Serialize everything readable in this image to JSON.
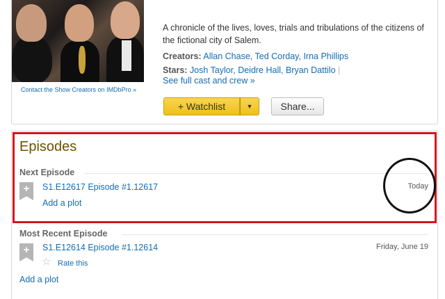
{
  "header": {
    "photo_caption": "Contact the Show Creators on IMDbPro »",
    "summary": "A chronicle of the lives, loves, trials and tribulations of the citizens of the fictional city of Salem.",
    "creators_label": "Creators:",
    "creators": [
      "Allan Chase,",
      "Ted Corday,",
      "Irna Phillips"
    ],
    "stars_label": "Stars:",
    "stars": [
      "Josh Taylor,",
      "Deidre Hall,",
      "Bryan Dattilo"
    ],
    "separator": "|",
    "full_cast_link": "See full cast and crew »",
    "watchlist_label": "+ Watchlist",
    "watchlist_arrow_icon": "caret-down-icon",
    "share_label": "Share..."
  },
  "episodes": {
    "title": "Episodes",
    "next": {
      "heading": "Next Episode",
      "plus_icon": "plus-bookmark-icon",
      "plus_glyph": "+",
      "link": "S1.E12617 Episode #1.12617",
      "add_plot": "Add a plot",
      "date": "Today"
    },
    "recent": {
      "heading": "Most Recent Episode",
      "plus_icon": "plus-bookmark-icon",
      "plus_glyph": "+",
      "link": "S1.E12614 Episode #1.12614",
      "date": "Friday, June 19",
      "rate_label": "Rate this",
      "add_plot": "Add a plot"
    }
  },
  "colors": {
    "link": "#136cb2",
    "highlight_box": "#d8131f",
    "watchlist_button": "#f5c518",
    "section_title": "#6b5200"
  }
}
